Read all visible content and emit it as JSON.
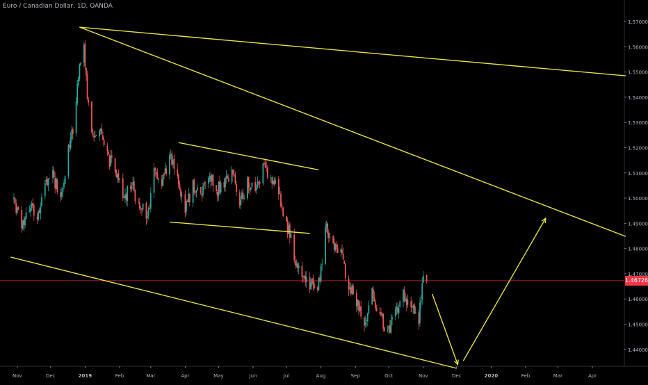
{
  "title": "Euro / Canadian Dollar, 1D, OANDA",
  "chart_data": {
    "type": "candlestick",
    "title": "Euro / Canadian Dollar, 1D, OANDA",
    "symbol": "EURCAD",
    "interval": "1D",
    "source": "OANDA",
    "ylim": [
      1.4325,
      1.5725
    ],
    "y_ticks": [
      "1.57000",
      "1.56000",
      "1.55000",
      "1.54000",
      "1.53000",
      "1.52000",
      "1.51000",
      "1.50000",
      "1.49000",
      "1.48000",
      "1.47000",
      "1.46000",
      "1.45000",
      "1.44000"
    ],
    "x_ticks": [
      "Nov",
      "Dec",
      "2019",
      "Feb",
      "Mar",
      "Apr",
      "May",
      "Jun",
      "Jul",
      "Aug",
      "Sep",
      "Oct",
      "Nov",
      "Dec",
      "2020",
      "Feb",
      "Mar",
      "Apr"
    ],
    "x_start": "2018-10-29",
    "last_price": "1.46726",
    "last_price_value": 1.46726,
    "grid": false,
    "colors": {
      "background": "#000000",
      "up": "#26a69a",
      "down": "#ef5350",
      "drawings": "#e8e040",
      "axis_text": "#b2b5be",
      "last_price": "#f23645"
    },
    "price_path": [
      [
        "2018-10-29",
        1.5
      ],
      [
        "2018-11-05",
        1.49
      ],
      [
        "2018-11-12",
        1.497
      ],
      [
        "2018-11-19",
        1.492
      ],
      [
        "2018-11-26",
        1.505
      ],
      [
        "2018-12-03",
        1.51
      ],
      [
        "2018-12-10",
        1.498
      ],
      [
        "2018-12-17",
        1.52
      ],
      [
        "2018-12-21",
        1.528
      ],
      [
        "2018-12-26",
        1.548
      ],
      [
        "2018-12-31",
        1.562
      ],
      [
        "2019-01-03",
        1.54
      ],
      [
        "2019-01-08",
        1.523
      ],
      [
        "2019-01-15",
        1.528
      ],
      [
        "2019-01-22",
        1.516
      ],
      [
        "2019-01-29",
        1.51
      ],
      [
        "2019-02-05",
        1.5
      ],
      [
        "2019-02-12",
        1.505
      ],
      [
        "2019-02-19",
        1.497
      ],
      [
        "2019-02-26",
        1.493
      ],
      [
        "2019-03-04",
        1.51
      ],
      [
        "2019-03-11",
        1.505
      ],
      [
        "2019-03-18",
        1.518
      ],
      [
        "2019-03-25",
        1.508
      ],
      [
        "2019-04-01",
        1.495
      ],
      [
        "2019-04-08",
        1.505
      ],
      [
        "2019-04-15",
        1.5
      ],
      [
        "2019-04-22",
        1.51
      ],
      [
        "2019-04-29",
        1.503
      ],
      [
        "2019-05-06",
        1.505
      ],
      [
        "2019-05-13",
        1.512
      ],
      [
        "2019-05-20",
        1.498
      ],
      [
        "2019-05-27",
        1.506
      ],
      [
        "2019-06-03",
        1.502
      ],
      [
        "2019-06-10",
        1.512
      ],
      [
        "2019-06-17",
        1.507
      ],
      [
        "2019-06-24",
        1.503
      ],
      [
        "2019-07-01",
        1.49
      ],
      [
        "2019-07-05",
        1.484
      ],
      [
        "2019-07-10",
        1.474
      ],
      [
        "2019-07-17",
        1.468
      ],
      [
        "2019-07-24",
        1.465
      ],
      [
        "2019-07-31",
        1.467
      ],
      [
        "2019-08-05",
        1.488
      ],
      [
        "2019-08-12",
        1.482
      ],
      [
        "2019-08-19",
        1.478
      ],
      [
        "2019-08-26",
        1.466
      ],
      [
        "2019-09-02",
        1.458
      ],
      [
        "2019-09-09",
        1.45
      ],
      [
        "2019-09-16",
        1.462
      ],
      [
        "2019-09-23",
        1.455
      ],
      [
        "2019-09-30",
        1.446
      ],
      [
        "2019-10-07",
        1.455
      ],
      [
        "2019-10-14",
        1.462
      ],
      [
        "2019-10-21",
        1.457
      ],
      [
        "2019-10-28",
        1.452
      ],
      [
        "2019-10-31",
        1.466
      ],
      [
        "2019-11-04",
        1.467
      ]
    ],
    "trendlines": [
      {
        "name": "upper-channel-line",
        "from": [
          "2018-12-27",
          1.5678
        ],
        "to": [
          "2020-05-01",
          1.5485
        ]
      },
      {
        "name": "main-descending-resistance",
        "from": [
          "2018-12-27",
          1.5678
        ],
        "to": [
          "2020-05-01",
          1.4848
        ]
      },
      {
        "name": "lower-channel-support",
        "from": [
          "2018-10-26",
          1.4766
        ],
        "to": [
          "2019-12-01",
          1.4325
        ]
      },
      {
        "name": "flag-top-line",
        "from": [
          "2019-03-26",
          1.522
        ],
        "to": [
          "2019-07-30",
          1.5112
        ]
      },
      {
        "name": "flag-bottom-line",
        "from": [
          "2019-03-18",
          1.4905
        ],
        "to": [
          "2019-07-22",
          1.486
        ]
      }
    ],
    "projection_arrows": [
      {
        "name": "projection-arrow-down",
        "from": [
          "2019-11-09",
          1.462
        ],
        "to": [
          "2019-12-02",
          1.434
        ]
      },
      {
        "name": "projection-arrow-up",
        "from": [
          "2019-12-07",
          1.4355
        ],
        "to": [
          "2020-02-19",
          1.492
        ]
      }
    ]
  }
}
